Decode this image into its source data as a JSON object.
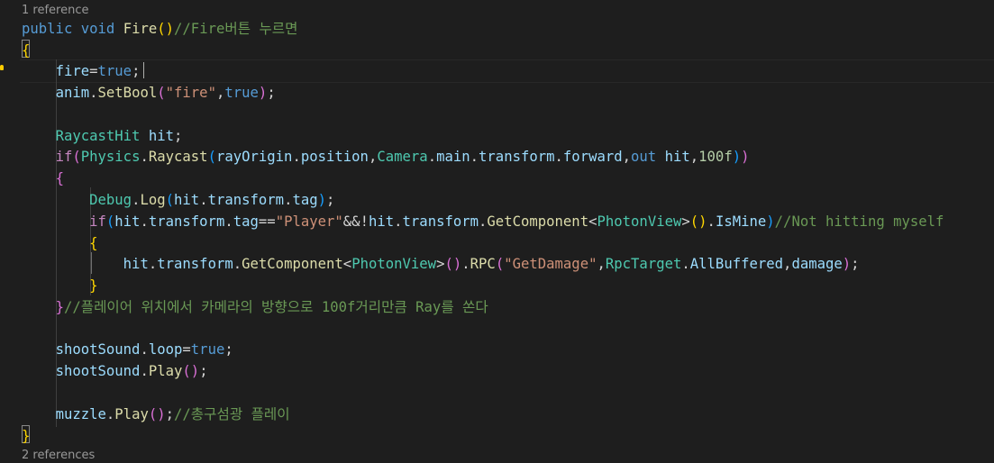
{
  "codelens": {
    "top": "1 reference",
    "bottom": "2 references"
  },
  "code": {
    "l1": {
      "public": "public",
      "void": "void",
      "fire": "Fire",
      "open": "(",
      "close": ")",
      "comment": "//Fire버튼 누르면"
    },
    "l2": {
      "brace": "{"
    },
    "l3": {
      "var": "fire",
      "eq": "=",
      "val": "true",
      "semi": ";"
    },
    "l4": {
      "obj": "anim",
      "dot": ".",
      "fn": "SetBool",
      "open": "(",
      "str": "\"fire\"",
      "comma": ",",
      "val": "true",
      "close": ")",
      "semi": ";"
    },
    "l5": {
      "type": "RaycastHit",
      "var": " hit",
      "semi": ";"
    },
    "l6": {
      "if": "if",
      "p1": "(",
      "physics": "Physics",
      "dot1": ".",
      "raycast": "Raycast",
      "p2": "(",
      "origin": "rayOrigin",
      "dot2": ".",
      "position": "position",
      "comma1": ",",
      "camera": "Camera",
      "dot3": ".",
      "main": "main",
      "dot4": ".",
      "transform": "transform",
      "dot5": ".",
      "forward": "forward",
      "comma2": ",",
      "out": "out",
      "hit": " hit",
      "comma3": ",",
      "num": "100f",
      "p3": ")",
      "p4": ")"
    },
    "l7": {
      "brace": "{"
    },
    "l8": {
      "debug": "Debug",
      "dot1": ".",
      "log": "Log",
      "open": "(",
      "hit": "hit",
      "dot2": ".",
      "transform": "transform",
      "dot3": ".",
      "tag": "tag",
      "close": ")",
      "semi": ";"
    },
    "l9": {
      "if": "if",
      "p1": "(",
      "hit": "hit",
      "dot1": ".",
      "transform": "transform",
      "dot2": ".",
      "tag": "tag",
      "eqeq": "==",
      "str": "\"Player\"",
      "and": "&&!",
      "hit2": "hit",
      "dot3": ".",
      "transform2": "transform",
      "dot4": ".",
      "getcomp": "GetComponent",
      "lt": "<",
      "photon": "PhotonView",
      "gt": ">",
      "p2": "(",
      "p3": ")",
      "dot5": ".",
      "ismine": "IsMine",
      "p4": ")",
      "comment": "//Not hitting myself"
    },
    "l10": {
      "brace": "{"
    },
    "l11": {
      "hit": "hit",
      "dot1": ".",
      "transform": "transform",
      "dot2": ".",
      "getcomp": "GetComponent",
      "lt": "<",
      "photon": "PhotonView",
      "gt": ">",
      "p1": "(",
      "p2": ")",
      "dot3": ".",
      "rpc": "RPC",
      "p3": "(",
      "str": "\"GetDamage\"",
      "comma1": ",",
      "rpctarget": "RpcTarget",
      "dot4": ".",
      "allbuffered": "AllBuffered",
      "comma2": ",",
      "damage": "damage",
      "p4": ")",
      "semi": ";"
    },
    "l12": {
      "brace": "}"
    },
    "l13": {
      "brace": "}",
      "comment": "//플레이어 위치에서 카메라의 방향으로 100f거리만큼 Ray를 쏜다"
    },
    "l14": {
      "obj": "shootSound",
      "dot": ".",
      "loop": "loop",
      "eq": "=",
      "val": "true",
      "semi": ";"
    },
    "l15": {
      "obj": "shootSound",
      "dot": ".",
      "fn": "Play",
      "p1": "(",
      "p2": ")",
      "semi": ";"
    },
    "l16": {
      "obj": "muzzle",
      "dot": ".",
      "fn": "Play",
      "p1": "(",
      "p2": ")",
      "semi": ";",
      "comment": "//총구섬광 플레이"
    },
    "l17": {
      "brace": "}"
    }
  },
  "colors": {
    "background": "#1e1e1e",
    "keyword": "#569cd6",
    "control": "#c586c0",
    "function": "#dcdcaa",
    "variable": "#9cdcfe",
    "type": "#4ec9b0",
    "string": "#ce9178",
    "number": "#b5cea8",
    "comment": "#6a9955"
  },
  "icons": {
    "lightbulb": "lightbulb-icon"
  }
}
